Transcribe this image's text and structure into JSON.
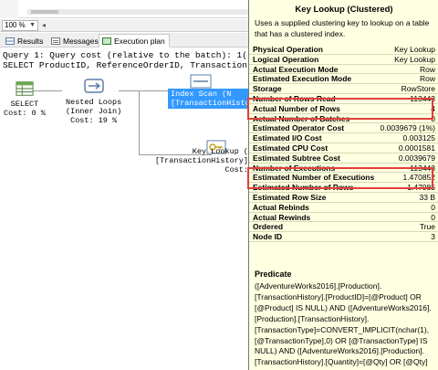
{
  "zoom": {
    "value": "100 %"
  },
  "tabs": [
    {
      "label": "Results"
    },
    {
      "label": "Messages"
    },
    {
      "label": "Execution plan"
    }
  ],
  "query": {
    "header": "Query 1: Query cost (relative to the batch): 1(",
    "sql": "SELECT ProductID, ReferenceOrderID, Transaction"
  },
  "plan": {
    "select": {
      "name": "SELECT",
      "cost": "Cost: 0 %"
    },
    "nested_loops": {
      "name": "Nested Loops",
      "sub": "(Inner Join)",
      "cost": "Cost: 19 %"
    },
    "index_scan": {
      "label_line1": "Index Scan (N",
      "label_line2": "[TransactionHistory"
    },
    "key_lookup": {
      "name": "Key Lookup (",
      "sub": "[TransactionHistory]",
      "cost": "Cost:"
    }
  },
  "tooltip": {
    "title": "Key Lookup (Clustered)",
    "description": "Uses a supplied clustering key to lookup on a table that has a clustered index.",
    "rows": [
      {
        "key": "Physical Operation",
        "value": "Key Lookup"
      },
      {
        "key": "Logical Operation",
        "value": "Key Lookup"
      },
      {
        "key": "Actual Execution Mode",
        "value": "Row"
      },
      {
        "key": "Estimated Execution Mode",
        "value": "Row"
      },
      {
        "key": "Storage",
        "value": "RowStore"
      },
      {
        "key": "Number of Rows Read",
        "value": "113443"
      },
      {
        "key": "Actual Number of Rows",
        "value": "4"
      },
      {
        "key": "Actual Number of Batches",
        "value": "0"
      },
      {
        "key": "Estimated Operator Cost",
        "value": "0.0039679 (1%)"
      },
      {
        "key": "Estimated I/O Cost",
        "value": "0.003125"
      },
      {
        "key": "Estimated CPU Cost",
        "value": "0.0001581"
      },
      {
        "key": "Estimated Subtree Cost",
        "value": "0.0039679"
      },
      {
        "key": "Number of Executions",
        "value": "113443"
      },
      {
        "key": "Estimated Number of Executions",
        "value": "1.470852"
      },
      {
        "key": "Estimated Number of Rows",
        "value": "1.47085"
      },
      {
        "key": "Estimated Row Size",
        "value": "33 B"
      },
      {
        "key": "Actual Rebinds",
        "value": "0"
      },
      {
        "key": "Actual Rewinds",
        "value": "0"
      },
      {
        "key": "Ordered",
        "value": "True"
      },
      {
        "key": "Node ID",
        "value": "3"
      }
    ],
    "predicate_title": "Predicate",
    "predicate": "([AdventureWorks2016].[Production].[TransactionHistory].[ProductID]=[@Product] OR [@Product] IS NULL) AND ([AdventureWorks2016].[Production].[TransactionHistory].[TransactionType]=CONVERT_IMPLICIT(nchar(1),[@TransactionType],0) OR [@TransactionType] IS NULL) AND ([AdventureWorks2016].[Production].[TransactionHistory].[Quantity]=[@Qty] OR [@Qty] IS NULL)"
  },
  "colors": {
    "tooltip_bg": "#ffffe1",
    "highlight": "#e0403a",
    "selection": "#3399ff"
  }
}
